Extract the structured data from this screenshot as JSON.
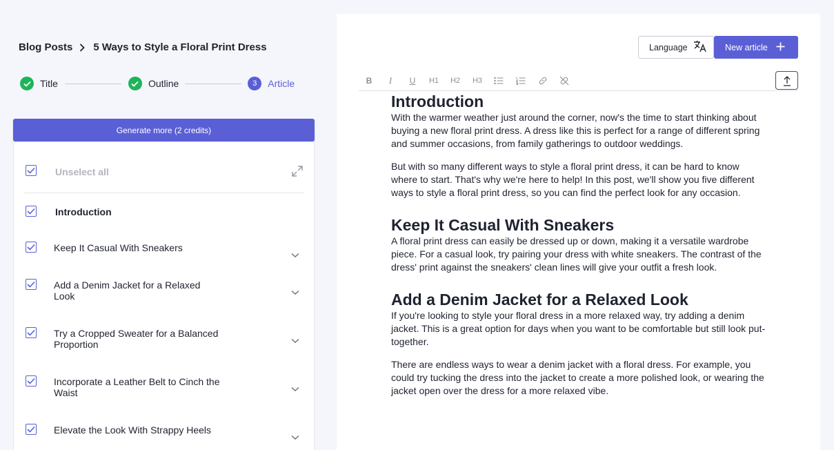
{
  "breadcrumb": {
    "root": "Blog Posts",
    "current": "5 Ways to Style a Floral Print Dress"
  },
  "steps": [
    {
      "label": "Title",
      "state": "done"
    },
    {
      "label": "Outline",
      "state": "done"
    },
    {
      "label": "Article",
      "number": "3",
      "state": "active"
    }
  ],
  "generate_button": "Generate more (2 credits)",
  "outline": {
    "unselect_all": "Unselect all",
    "items": [
      {
        "label": "Introduction",
        "checked": true
      },
      {
        "label": "Keep It Casual With Sneakers",
        "checked": true
      },
      {
        "label": "Add a Denim Jacket for a Relaxed Look",
        "checked": true
      },
      {
        "label": "Try a Cropped Sweater for a Balanced Proportion",
        "checked": true
      },
      {
        "label": "Incorporate a Leather Belt to Cinch the Waist",
        "checked": true
      },
      {
        "label": "Elevate the Look With Strappy Heels",
        "checked": true
      }
    ]
  },
  "editor": {
    "language_button": "Language",
    "new_article_button": "New article",
    "toolbar": [
      "B",
      "I",
      "U",
      "H1",
      "H2",
      "H3",
      "bullet-list",
      "numbered-list",
      "link",
      "unlink"
    ],
    "sections": [
      {
        "heading": "Introduction",
        "paragraphs": [
          "With the warmer weather just around the corner, now's the time to start thinking about buying a new floral print dress. A dress like this is perfect for a range of different spring and summer occasions, from family gatherings to outdoor weddings.",
          "But with so many different ways to style a floral print dress, it can be hard to know where to start. That's why we're here to help! In this post, we'll show you five different ways to style a floral print dress, so you can find the perfect look for any occasion."
        ]
      },
      {
        "heading": "Keep It Casual With Sneakers",
        "paragraphs": [
          "A floral print dress can easily be dressed up or down, making it a versatile wardrobe piece. For a casual look, try pairing your dress with white sneakers. The contrast of the dress' print against the sneakers' clean lines will give your outfit a fresh look."
        ]
      },
      {
        "heading": "Add a Denim Jacket for a Relaxed Look",
        "paragraphs": [
          "If you're looking to style your floral dress in a more relaxed way, try adding a denim jacket. This is a great option for days when you want to be comfortable but still look put-together.",
          "There are endless ways to wear a denim jacket with a floral dress. For example, you could try tucking the dress into the jacket to create a more polished look, or wearing the jacket open over the dress for a more relaxed vibe."
        ]
      }
    ]
  },
  "colors": {
    "accent": "#5a5fd6",
    "success": "#1fb45a",
    "background": "#f5f6fb"
  }
}
